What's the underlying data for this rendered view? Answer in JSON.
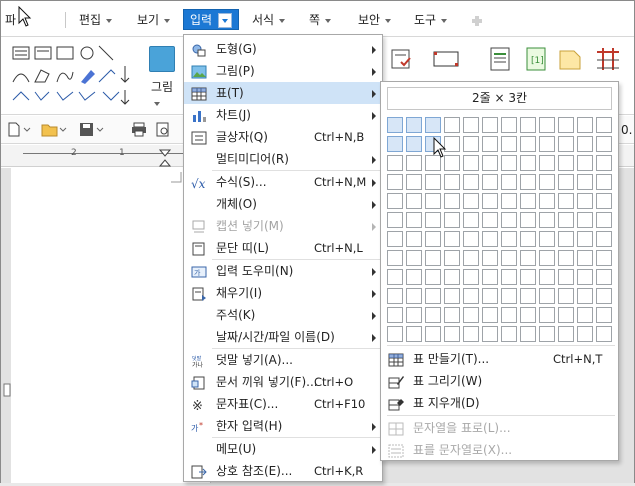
{
  "menubar": {
    "partial": "파",
    "items": [
      {
        "label": "편집"
      },
      {
        "label": "보기"
      },
      {
        "label": "입력"
      },
      {
        "label": "서식"
      },
      {
        "label": "쪽"
      },
      {
        "label": "보안"
      },
      {
        "label": "도구"
      }
    ]
  },
  "ribbon": {
    "picture_label": "그림",
    "zoom_partial": "0."
  },
  "ruler": {
    "tick_2": "2",
    "tick_1": "1"
  },
  "insert_menu": {
    "items": [
      {
        "label": "도형(G)",
        "shortcut": "",
        "submenu": true,
        "icon": "shape-icon"
      },
      {
        "label": "그림(P)",
        "shortcut": "",
        "submenu": true,
        "icon": "picture-icon"
      },
      {
        "label": "표(T)",
        "shortcut": "",
        "submenu": true,
        "icon": "table-icon"
      },
      {
        "label": "차트(J)",
        "shortcut": "",
        "submenu": true,
        "icon": "chart-icon"
      },
      {
        "label": "글상자(Q)",
        "shortcut": "Ctrl+N,B",
        "submenu": false,
        "icon": "textbox-icon"
      },
      {
        "label": "멀티미디어(R)",
        "shortcut": "",
        "submenu": true,
        "icon": ""
      },
      {
        "label": "수식(S)...",
        "shortcut": "Ctrl+N,M",
        "submenu": true,
        "icon": "formula-icon"
      },
      {
        "label": "개체(O)",
        "shortcut": "",
        "submenu": true,
        "icon": ""
      },
      {
        "label": "캡션 넣기(M)",
        "shortcut": "",
        "submenu": true,
        "icon": "caption-icon"
      },
      {
        "label": "문단 띠(L)",
        "shortcut": "Ctrl+N,L",
        "submenu": false,
        "icon": "paragraph-band-icon"
      },
      {
        "label": "입력 도우미(N)",
        "shortcut": "",
        "submenu": true,
        "icon": "input-helper-icon"
      },
      {
        "label": "채우기(I)",
        "shortcut": "",
        "submenu": true,
        "icon": "fill-icon"
      },
      {
        "label": "주석(K)",
        "shortcut": "",
        "submenu": true,
        "icon": ""
      },
      {
        "label": "날짜/시간/파일 이름(D)",
        "shortcut": "",
        "submenu": true,
        "icon": ""
      },
      {
        "label": "덧말 넣기(A)...",
        "shortcut": "",
        "submenu": false,
        "icon": "ruby-text-icon"
      },
      {
        "label": "문서 끼워 넣기(F)...",
        "shortcut": "Ctrl+O",
        "submenu": false,
        "icon": "insert-document-icon"
      },
      {
        "label": "문자표(C)...",
        "shortcut": "Ctrl+F10",
        "submenu": false,
        "icon": "symbol-icon"
      },
      {
        "label": "한자 입력(H)",
        "shortcut": "",
        "submenu": true,
        "icon": "hanja-icon"
      },
      {
        "label": "메모(U)",
        "shortcut": "",
        "submenu": true,
        "icon": ""
      },
      {
        "label": "상호 참조(E)...",
        "shortcut": "Ctrl+K,R",
        "submenu": false,
        "icon": "cross-reference-icon"
      }
    ]
  },
  "table_menu": {
    "grid_label": "2줄 × 3칸",
    "grid_rows": 12,
    "grid_cols": 12,
    "selected_rows": 2,
    "selected_cols": 3,
    "items": [
      {
        "label": "표 만들기(T)...",
        "shortcut": "Ctrl+N,T",
        "icon": "create-table-icon"
      },
      {
        "label": "표 그리기(W)",
        "shortcut": "",
        "icon": "draw-table-icon"
      },
      {
        "label": "표 지우개(D)",
        "shortcut": "",
        "icon": "table-eraser-icon"
      },
      {
        "label": "문자열을 표로(L)...",
        "shortcut": "",
        "icon": "text-to-table-icon"
      },
      {
        "label": "표를 문자열로(X)...",
        "shortcut": "",
        "icon": "table-to-text-icon"
      }
    ]
  }
}
